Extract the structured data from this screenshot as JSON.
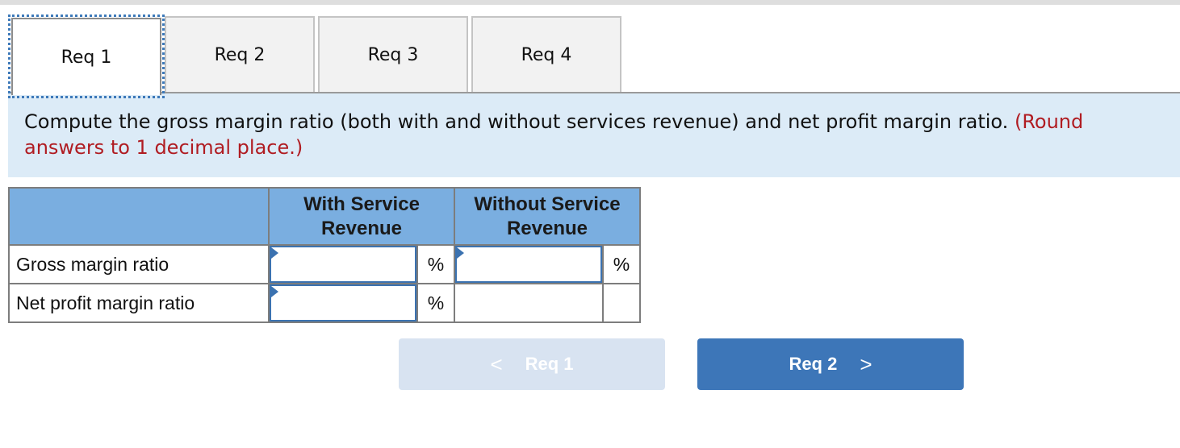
{
  "tabs": [
    {
      "label": "Req 1",
      "active": true
    },
    {
      "label": "Req 2",
      "active": false
    },
    {
      "label": "Req 3",
      "active": false
    },
    {
      "label": "Req 4",
      "active": false
    }
  ],
  "instructions": {
    "main_text": "Compute the gross margin ratio (both with and without services revenue) and net profit margin ratio. ",
    "note_text_line1": "(Round",
    "note_text_line2": "answers to 1 decimal place.)"
  },
  "table": {
    "headers": [
      "",
      "With Service\nRevenue",
      "Without Service\nRevenue"
    ],
    "header_with_line1": "With Service",
    "header_with_line2": "Revenue",
    "header_without_line1": "Without Service",
    "header_without_line2": "Revenue",
    "rows": [
      {
        "label": "Gross margin ratio",
        "with_value": "",
        "with_unit": "%",
        "without_value": "",
        "without_unit": "%"
      },
      {
        "label": "Net profit margin ratio",
        "with_value": "",
        "with_unit": "%",
        "without_value": "",
        "without_unit": ""
      }
    ]
  },
  "navigation": {
    "prev_label": "Req 1",
    "prev_icon": "chevron-left-icon",
    "prev_chevron": "<",
    "next_label": "Req 2",
    "next_icon": "chevron-right-icon",
    "next_chevron": ">"
  },
  "colors": {
    "accent": "#3d76b8",
    "header_bg": "#7aaee0",
    "instruction_bg": "#dcebf7",
    "note_red": "#b01c22"
  }
}
